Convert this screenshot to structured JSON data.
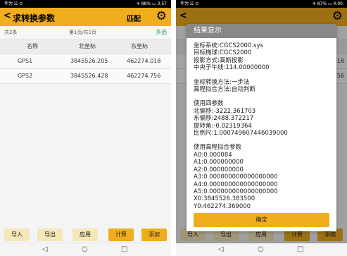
{
  "left": {
    "status": {
      "left": "华为 ☵ ⊙",
      "right": "✳ 88% ▭ 3:57"
    },
    "title": "求转换参数",
    "match_label": "匹配",
    "count": "共2条",
    "page": "第1页/共1页",
    "multi_select": "多选",
    "columns": [
      "名称",
      "北坐标",
      "东坐标"
    ],
    "rows": [
      {
        "name": "GPS1",
        "north": "3845526.205",
        "east": "462274.018"
      },
      {
        "name": "GPS2",
        "north": "3845526.428",
        "east": "462274.756"
      }
    ],
    "buttons": {
      "import": "导入",
      "export": "导出",
      "apply": "应用",
      "calc": "计算",
      "add": "添加"
    },
    "nav": {
      "back": "◁",
      "home": "○",
      "recent": "□"
    }
  },
  "right": {
    "status": {
      "left": "华为 ☵ ⊙",
      "right": "✳ 87% ▭ 4:00"
    },
    "behind_row_values": [
      "018",
      "756"
    ],
    "dialog": {
      "title": "结果显示",
      "lines1": [
        "坐标系统:CGCS2000.sys",
        "目标椭球:CGCS2000",
        "投影方式:高斯投影",
        "中央子午线:114.00000000"
      ],
      "lines2": [
        "坐标转换方法:一步法",
        "高程拟合方法:自动判断"
      ],
      "lines3": [
        "使用四参数",
        "北偏移:-3222.361703",
        "东偏移:2488.372217",
        "旋转角:-0.02319364",
        "比例尺:1.000749607446039000"
      ],
      "lines4": [
        "使用高程拟合参数",
        "A0:0.000084",
        "A1:0.000000000",
        "A2:0.000000000",
        "A3:0.000000000000000000",
        "A4:0.000000000000000000",
        "A5:0.000000000000000000",
        "X0:3845526.383500",
        "Y0:462274.369000"
      ],
      "ok_label": "确定"
    },
    "buttons": {
      "import": "导入",
      "export": "导出",
      "apply": "应用",
      "calc": "计算",
      "add": "添加"
    },
    "nav": {
      "back": "◁",
      "home": "○",
      "recent": "□"
    }
  }
}
